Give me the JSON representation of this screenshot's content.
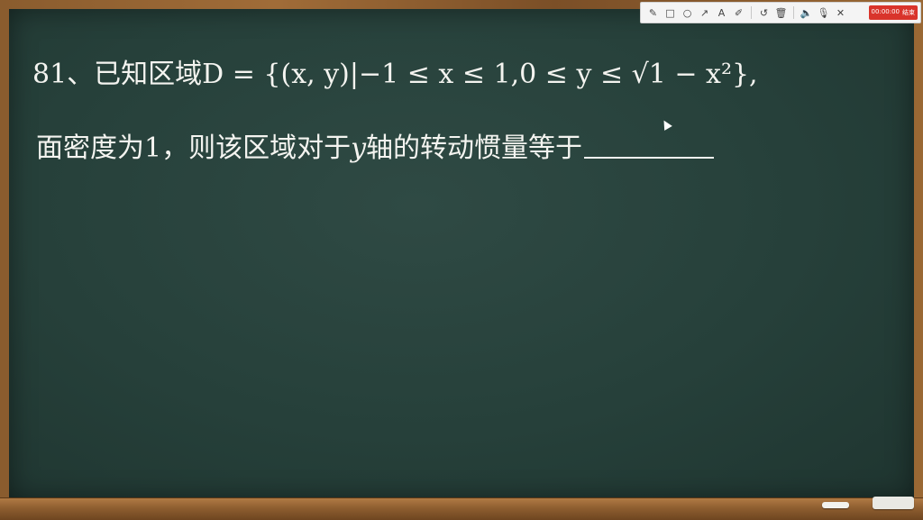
{
  "toolbar": {
    "tools": [
      "pen-icon",
      "rect-icon",
      "circle-icon",
      "arrow-icon",
      "text-icon",
      "highlighter-icon",
      "undo-icon",
      "trash-icon",
      "speaker-icon",
      "mic-icon",
      "close-icon"
    ],
    "timer": "00:00:00",
    "end_label": "结束"
  },
  "problem": {
    "line1": "81、已知区域D = {(x, y)|−1 ≤ x ≤ 1,0 ≤ y ≤ √1 − x²},",
    "line2_prefix": "面密度为1，则该区域对于",
    "line2_var": "y",
    "line2_suffix": "轴的转动惯量等于"
  }
}
